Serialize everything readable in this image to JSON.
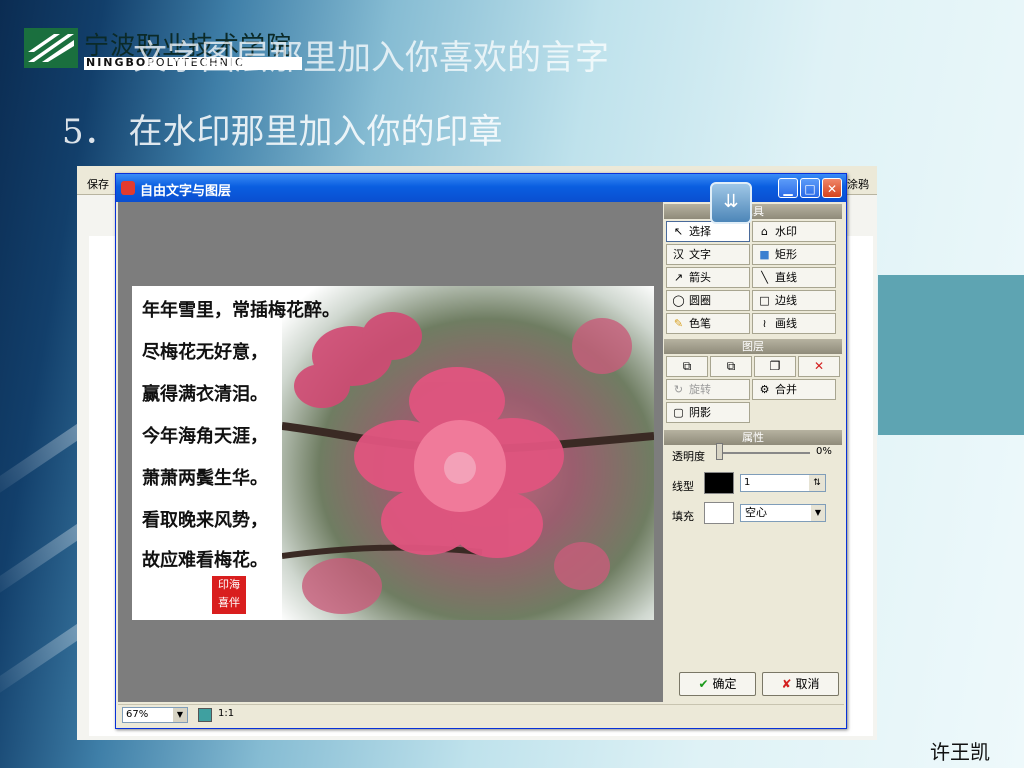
{
  "slide": {
    "logo_cn": "宁波职业技术学院",
    "logo_en_bold": "NINGBO",
    "logo_en_rest": "POLYTECHNIC",
    "line1": "文字图层那里加入你喜欢的言字",
    "line2": "5． 在水印那里加入你的印章",
    "author": "许王凯"
  },
  "background_app": {
    "save_label": "保存",
    "right_label": "涂鸦"
  },
  "dialog": {
    "title": "自由文字与图层",
    "poem_lines": [
      "年年雪里，常插梅花醉。",
      "尽梅花无好意，",
      "赢得满衣清泪。",
      "今年海角天涯，",
      "萧萧两鬓生华。",
      "看取晚来风势，",
      "故应难看梅花。"
    ],
    "seal_text": [
      "印海",
      "喜伴"
    ],
    "tools_header": "工具",
    "tools": [
      {
        "label": "选择",
        "icon": "cursor-arrow-icon",
        "glyph": "↖"
      },
      {
        "label": "水印",
        "icon": "watermark-icon",
        "glyph": "⌂"
      },
      {
        "label": "文字",
        "icon": "text-icon",
        "glyph": "汉"
      },
      {
        "label": "矩形",
        "icon": "rectangle-icon",
        "glyph": "■"
      },
      {
        "label": "箭头",
        "icon": "arrow-icon",
        "glyph": "↗"
      },
      {
        "label": "直线",
        "icon": "line-icon",
        "glyph": "╲"
      },
      {
        "label": "圆圈",
        "icon": "ellipse-icon",
        "glyph": "◯"
      },
      {
        "label": "边线",
        "icon": "border-icon",
        "glyph": "□"
      },
      {
        "label": "色笔",
        "icon": "pen-icon",
        "glyph": "✎"
      },
      {
        "label": "画线",
        "icon": "freehand-icon",
        "glyph": "≀"
      }
    ],
    "layers_header": "图层",
    "layer_icons": [
      {
        "icon": "bring-forward-icon",
        "glyph": "⧉"
      },
      {
        "icon": "send-backward-icon",
        "glyph": "⧉"
      },
      {
        "icon": "copy-layer-icon",
        "glyph": "❐"
      },
      {
        "icon": "delete-layer-icon",
        "glyph": "✕"
      }
    ],
    "rotate_label": "旋转",
    "merge_label": "合并",
    "shadow_label": "阴影",
    "props_header": "属性",
    "opacity_label": "透明度",
    "opacity_value": "0%",
    "opacity_level": 0,
    "line_label": "线型",
    "line_value": "1",
    "fill_label": "填充",
    "fill_value": "空心",
    "ok_label": "确定",
    "cancel_label": "取消",
    "zoom_value": "67%",
    "actual_size_label": "1:1"
  },
  "colors": {
    "titlebar": "#0a5ee0",
    "line_color": "#000000",
    "fill_color": "#ffffff",
    "seal": "#d91e1e",
    "teal_block": "#5ea4b2"
  }
}
